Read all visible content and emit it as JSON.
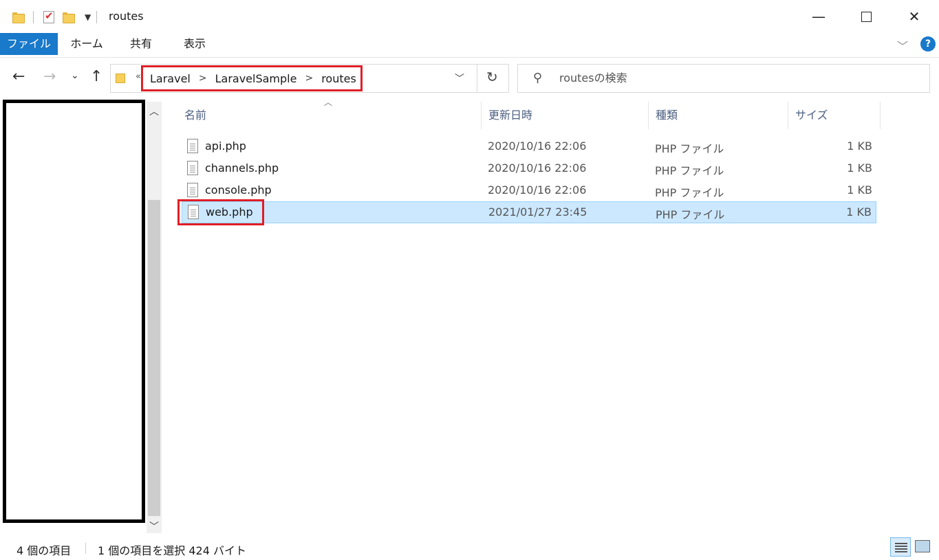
{
  "window": {
    "title": "routes",
    "minimize_glyph": "—",
    "close_glyph": "✕"
  },
  "ribbon": {
    "tabs": [
      "ファイル",
      "ホーム",
      "共有",
      "表示"
    ],
    "help_glyph": "?"
  },
  "nav": {
    "breadcrumbs": [
      "Laravel",
      "LaravelSample",
      "routes"
    ],
    "search_placeholder": "routesの検索"
  },
  "columns": {
    "name": "名前",
    "date": "更新日時",
    "type": "種類",
    "size": "サイズ"
  },
  "files": [
    {
      "name": "api.php",
      "date": "2020/10/16 22:06",
      "type": "PHP ファイル",
      "size": "1 KB",
      "selected": false
    },
    {
      "name": "channels.php",
      "date": "2020/10/16 22:06",
      "type": "PHP ファイル",
      "size": "1 KB",
      "selected": false
    },
    {
      "name": "console.php",
      "date": "2020/10/16 22:06",
      "type": "PHP ファイル",
      "size": "1 KB",
      "selected": false
    },
    {
      "name": "web.php",
      "date": "2021/01/27 23:45",
      "type": "PHP ファイル",
      "size": "1 KB",
      "selected": true
    }
  ],
  "status": {
    "item_count": "4 個の項目",
    "selection": "1 個の項目を選択  424 バイト"
  },
  "colors": {
    "accent": "#1979ca",
    "highlight_red": "#e01e26",
    "selection_bg": "#cce8ff"
  }
}
